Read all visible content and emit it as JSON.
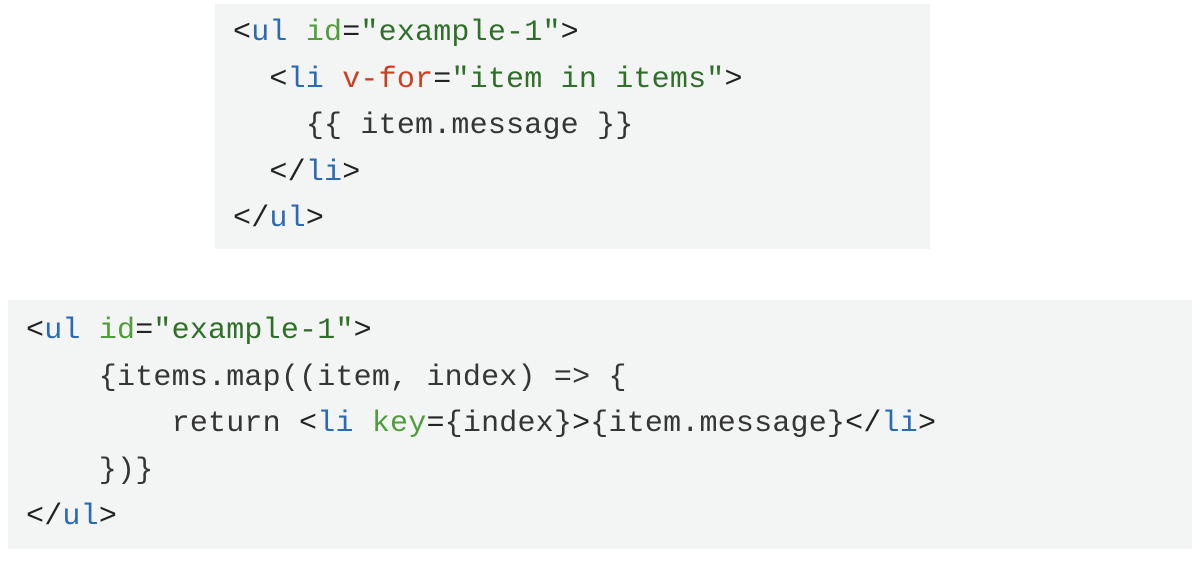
{
  "blocks": {
    "top": {
      "lines": [
        [
          {
            "t": "<",
            "c": "punct"
          },
          {
            "t": "ul",
            "c": "tag"
          },
          {
            "t": " ",
            "c": "punct"
          },
          {
            "t": "id",
            "c": "attr"
          },
          {
            "t": "=",
            "c": "punct"
          },
          {
            "t": "\"example-1\"",
            "c": "str"
          },
          {
            "t": ">",
            "c": "punct"
          }
        ],
        [
          {
            "t": "  ",
            "c": "punct"
          },
          {
            "t": "<",
            "c": "punct"
          },
          {
            "t": "li",
            "c": "tag"
          },
          {
            "t": " ",
            "c": "punct"
          },
          {
            "t": "v-for",
            "c": "dir"
          },
          {
            "t": "=",
            "c": "punct"
          },
          {
            "t": "\"item in items\"",
            "c": "str"
          },
          {
            "t": ">",
            "c": "punct"
          }
        ],
        [
          {
            "t": "    ",
            "c": "punct"
          },
          {
            "t": "{{ item.message }}",
            "c": "txt"
          }
        ],
        [
          {
            "t": "  ",
            "c": "punct"
          },
          {
            "t": "</",
            "c": "punct"
          },
          {
            "t": "li",
            "c": "tag"
          },
          {
            "t": ">",
            "c": "punct"
          }
        ],
        [
          {
            "t": "</",
            "c": "punct"
          },
          {
            "t": "ul",
            "c": "tag"
          },
          {
            "t": ">",
            "c": "punct"
          }
        ]
      ]
    },
    "bottom": {
      "lines": [
        [
          {
            "t": "<",
            "c": "punct"
          },
          {
            "t": "ul",
            "c": "tag"
          },
          {
            "t": " ",
            "c": "punct"
          },
          {
            "t": "id",
            "c": "attr"
          },
          {
            "t": "=",
            "c": "punct"
          },
          {
            "t": "\"example-1\"",
            "c": "str"
          },
          {
            "t": ">",
            "c": "punct"
          }
        ],
        [
          {
            "t": "    {items.map((item, index) => {",
            "c": "txt"
          }
        ],
        [
          {
            "t": "        return ",
            "c": "txt"
          },
          {
            "t": "<",
            "c": "punct"
          },
          {
            "t": "li",
            "c": "tag"
          },
          {
            "t": " ",
            "c": "punct"
          },
          {
            "t": "key",
            "c": "attr"
          },
          {
            "t": "=",
            "c": "punct"
          },
          {
            "t": "{index}",
            "c": "txt"
          },
          {
            "t": ">",
            "c": "punct"
          },
          {
            "t": "{item.message}",
            "c": "txt"
          },
          {
            "t": "</",
            "c": "punct"
          },
          {
            "t": "li",
            "c": "tag"
          },
          {
            "t": ">",
            "c": "punct"
          }
        ],
        [
          {
            "t": "    })}",
            "c": "txt"
          }
        ],
        [
          {
            "t": "</",
            "c": "punct"
          },
          {
            "t": "ul",
            "c": "tag"
          },
          {
            "t": ">",
            "c": "punct"
          }
        ]
      ]
    }
  }
}
